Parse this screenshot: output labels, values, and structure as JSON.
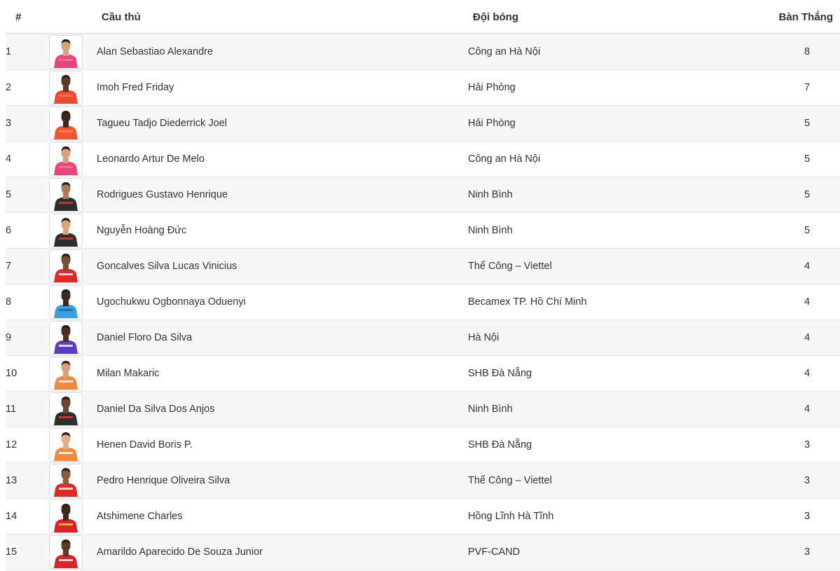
{
  "header": {
    "rank": "#",
    "player": "Cầu thủ",
    "team": "Đội bóng",
    "goals": "Bàn Thắng"
  },
  "rows": [
    {
      "rank": "1",
      "player": "Alan Sebastiao Alexandre",
      "team": "Công an Hà Nội",
      "goals": "8",
      "kit": "#e8457a",
      "skin": "#d9a07a",
      "accent": "#f27aa3"
    },
    {
      "rank": "2",
      "player": "Imoh Fred Friday",
      "team": "Hải Phòng",
      "goals": "7",
      "kit": "#f04a32",
      "skin": "#5a3a28",
      "accent": "#ff7a5a"
    },
    {
      "rank": "3",
      "player": "Tagueu Tadjo Diederrick Joel",
      "team": "Hải Phòng",
      "goals": "5",
      "kit": "#f0552e",
      "skin": "#3b261b",
      "accent": "#ff8a5c"
    },
    {
      "rank": "4",
      "player": "Leonardo Artur De Melo",
      "team": "Công an Hà Nội",
      "goals": "5",
      "kit": "#e8457a",
      "skin": "#d9a07a",
      "accent": "#f27aa3"
    },
    {
      "rank": "5",
      "player": "Rodrigues Gustavo Henrique",
      "team": "Ninh Bình",
      "goals": "5",
      "kit": "#2e2e2e",
      "skin": "#b07a55",
      "accent": "#e63b2e"
    },
    {
      "rank": "6",
      "player": "Nguyễn Hoàng Đức",
      "team": "Ninh Bình",
      "goals": "5",
      "kit": "#2e2e2e",
      "skin": "#d8a47c",
      "accent": "#e63b2e"
    },
    {
      "rank": "7",
      "player": "Goncalves Silva Lucas Vinicius",
      "team": "Thể Công – Viettel",
      "goals": "4",
      "kit": "#e02a2a",
      "skin": "#7a4c30",
      "accent": "#ffffff"
    },
    {
      "rank": "8",
      "player": "Ugochukwu Ogbonnaya Oduenyi",
      "team": "Becamex TP. Hồ Chí Minh",
      "goals": "4",
      "kit": "#3aa0e0",
      "skin": "#3d281c",
      "accent": "#1e5fa0"
    },
    {
      "rank": "9",
      "player": "Daniel Floro Da Silva",
      "team": "Hà Nội",
      "goals": "4",
      "kit": "#5a3fc0",
      "skin": "#4a3022",
      "accent": "#ffffff"
    },
    {
      "rank": "10",
      "player": "Milan Makaric",
      "team": "SHB Đà Nẵng",
      "goals": "4",
      "kit": "#f08a3a",
      "skin": "#d9a07a",
      "accent": "#ffffff"
    },
    {
      "rank": "11",
      "player": "Daniel Da Silva Dos Anjos",
      "team": "Ninh Bình",
      "goals": "4",
      "kit": "#2e2e2e",
      "skin": "#6a4430",
      "accent": "#e63b2e"
    },
    {
      "rank": "12",
      "player": "Henen David Boris P.",
      "team": "SHB Đà Nẵng",
      "goals": "3",
      "kit": "#f08a3a",
      "skin": "#e0b08a",
      "accent": "#ffffff"
    },
    {
      "rank": "13",
      "player": "Pedro Henrique Oliveira Silva",
      "team": "Thể Công – Viettel",
      "goals": "3",
      "kit": "#e02a2a",
      "skin": "#8a5a3a",
      "accent": "#ffffff"
    },
    {
      "rank": "14",
      "player": "Atshimene Charles",
      "team": "Hồng Lĩnh Hà Tĩnh",
      "goals": "3",
      "kit": "#d8242a",
      "skin": "#3d281c",
      "accent": "#f0d040"
    },
    {
      "rank": "15",
      "player": "Amarildo Aparecido De Souza Junior",
      "team": "PVF-CAND",
      "goals": "3",
      "kit": "#d8242a",
      "skin": "#5a3a28",
      "accent": "#ffffff"
    }
  ]
}
